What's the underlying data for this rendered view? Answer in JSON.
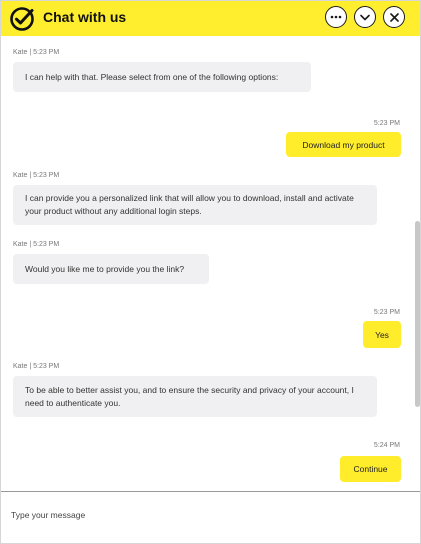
{
  "header": {
    "title": "Chat with us",
    "icons": [
      "logo-checkmark-icon",
      "more-icon",
      "minimize-icon",
      "close-icon"
    ],
    "accent_color": "#ffee2e"
  },
  "messages": [
    {
      "sender": "agent",
      "meta": "Kate  |  5:23 PM",
      "text": "I can help with that. Please select from one of the following options:"
    },
    {
      "sender": "user",
      "meta": "5:23 PM",
      "text": "Download my product"
    },
    {
      "sender": "agent",
      "meta": "Kate  |  5:23 PM",
      "text": "I can provide you a personalized link that will allow you to download, install and activate your product without any additional login steps."
    },
    {
      "sender": "agent",
      "meta": "Kate  |  5:23 PM",
      "text": "Would you like me to provide you the link?"
    },
    {
      "sender": "user",
      "meta": "5:23 PM",
      "text": "Yes"
    },
    {
      "sender": "agent",
      "meta": "Kate  |  5:23 PM",
      "text": "To be able to better assist you, and to ensure the security and privacy of your account, I need to authenticate you."
    },
    {
      "sender": "user",
      "meta": "5:24 PM",
      "text": "Continue"
    }
  ],
  "composer": {
    "placeholder": "Type your message"
  }
}
